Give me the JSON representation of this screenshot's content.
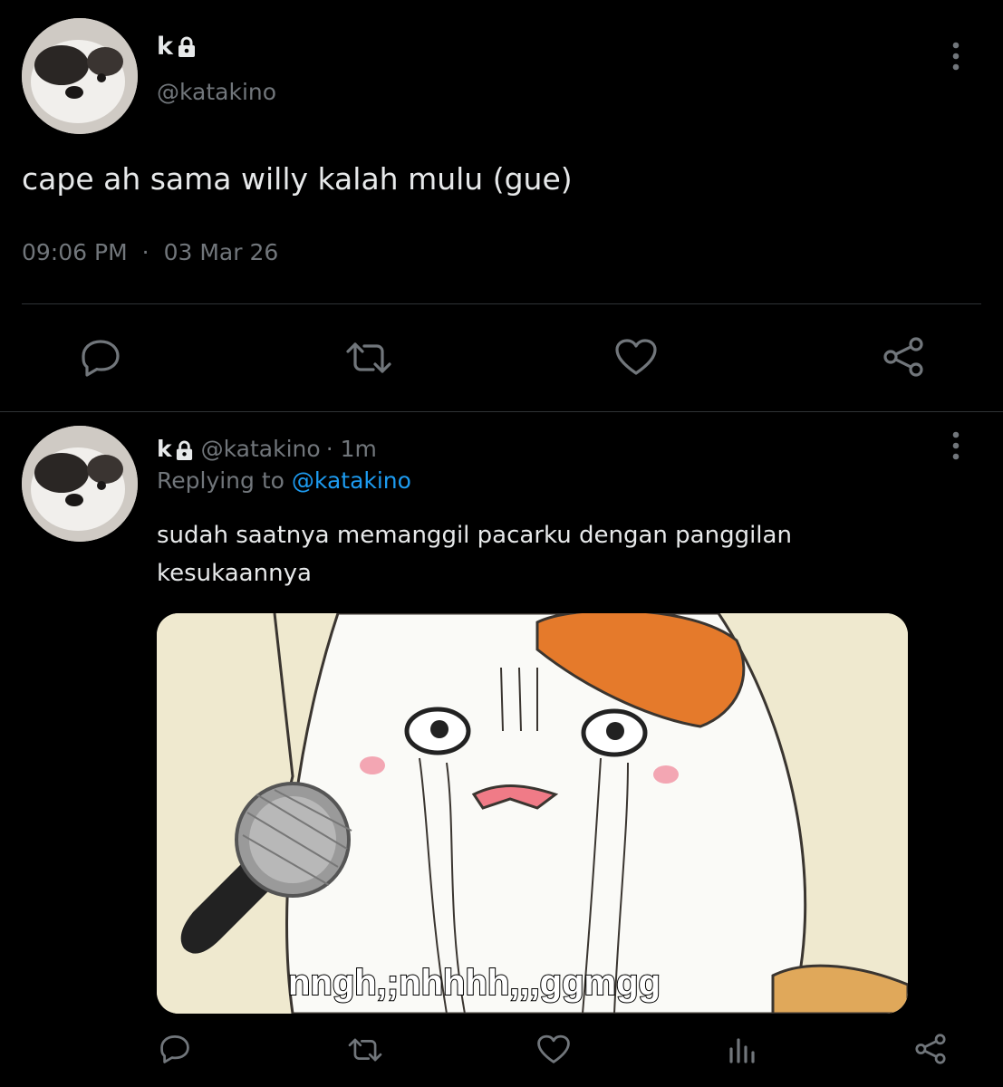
{
  "main_tweet": {
    "display_name": "k",
    "handle": "@katakino",
    "text": "cape ah sama willy kalah mulu (gue)",
    "time": "09:06 PM",
    "separator": "·",
    "date": "03 Mar 26"
  },
  "reply_tweet": {
    "display_name": "k",
    "handle": "@katakino",
    "age": "· 1m",
    "replying_prefix": "Replying to",
    "replying_handle": "@katakino",
    "text_line1": "sudah saatnya memanggil pacarku dengan panggilan",
    "text_line2": "kesukaannya",
    "media_caption": "nngh,;nhhhh,,,ggmgg"
  },
  "icons": {
    "more": "more-vertical-icon",
    "lock": "lock-icon",
    "reply": "reply-bubble-icon",
    "retweet": "retweet-icon",
    "like": "heart-icon",
    "share": "share-icon",
    "analytics": "analytics-icon"
  },
  "colors": {
    "background": "#000000",
    "text": "#e7e9ea",
    "muted": "#71767b",
    "link": "#1d9bf0"
  }
}
